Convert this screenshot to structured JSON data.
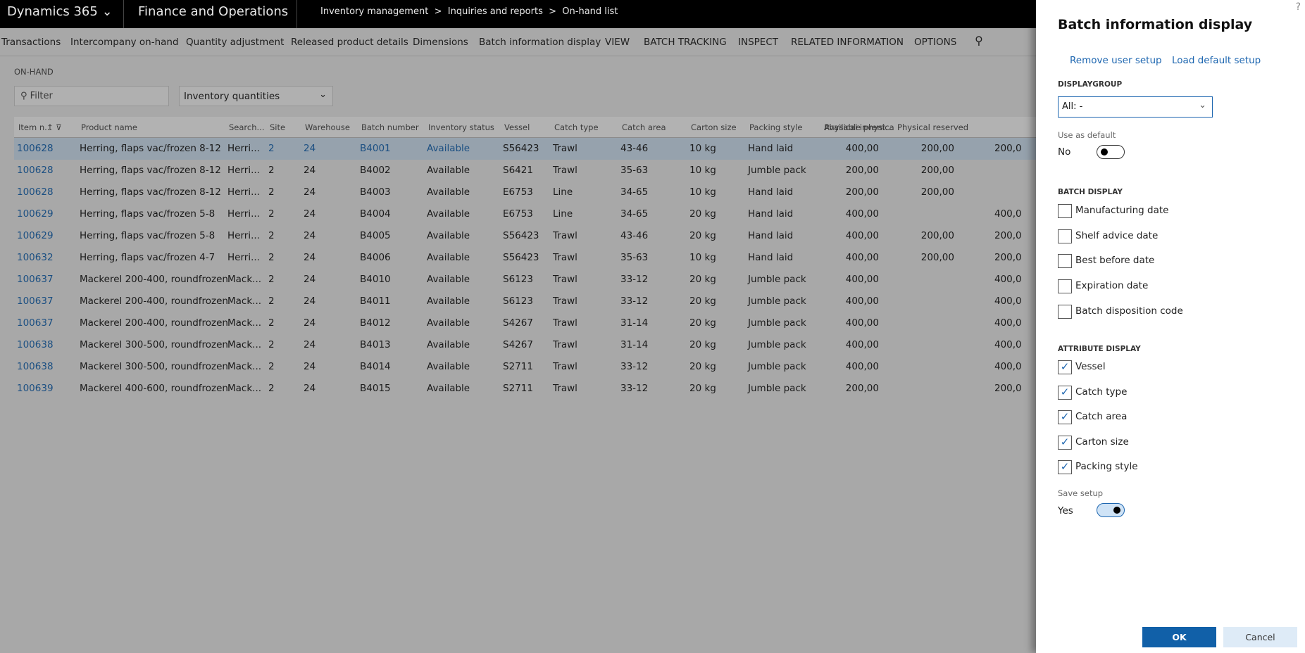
{
  "topbar": {
    "app": "Dynamics 365",
    "module": "Finance and Operations",
    "breadcrumb": [
      "Inventory management",
      "Inquiries and reports",
      "On-hand list"
    ]
  },
  "actions": [
    "Transactions",
    "Intercompany on-hand",
    "Quantity adjustment",
    "Released product details",
    "Dimensions",
    "Batch information display",
    "VIEW",
    "BATCH TRACKING",
    "INSPECT",
    "RELATED INFORMATION",
    "OPTIONS"
  ],
  "section": "ON-HAND",
  "filter": {
    "placeholder": "Filter"
  },
  "view_select": "Inventory quantities",
  "grid": {
    "columns": [
      "Item n...",
      "Product name",
      "Search...",
      "Site",
      "Warehouse",
      "Batch number",
      "Inventory status",
      "Vessel",
      "Catch type",
      "Catch area",
      "Carton size",
      "Packing style",
      "Physical invent...",
      "Physical reserved",
      "Available physica"
    ],
    "rows": [
      [
        "100628",
        "Herring, flaps vac/frozen 8-12",
        "Herri...",
        "2",
        "24",
        "B4001",
        "Available",
        "S56423",
        "Trawl",
        "43-46",
        "10 kg",
        "Hand laid",
        "400,00",
        "200,00",
        "200,0"
      ],
      [
        "100628",
        "Herring, flaps vac/frozen 8-12",
        "Herri...",
        "2",
        "24",
        "B4002",
        "Available",
        "S6421",
        "Trawl",
        "35-63",
        "10 kg",
        "Jumble pack",
        "200,00",
        "200,00",
        ""
      ],
      [
        "100628",
        "Herring, flaps vac/frozen 8-12",
        "Herri...",
        "2",
        "24",
        "B4003",
        "Available",
        "E6753",
        "Line",
        "34-65",
        "10 kg",
        "Hand laid",
        "200,00",
        "200,00",
        ""
      ],
      [
        "100629",
        "Herring, flaps vac/frozen 5-8",
        "Herri...",
        "2",
        "24",
        "B4004",
        "Available",
        "E6753",
        "Line",
        "34-65",
        "20 kg",
        "Hand laid",
        "400,00",
        "",
        "400,0"
      ],
      [
        "100629",
        "Herring, flaps vac/frozen 5-8",
        "Herri...",
        "2",
        "24",
        "B4005",
        "Available",
        "S56423",
        "Trawl",
        "43-46",
        "20 kg",
        "Hand laid",
        "400,00",
        "200,00",
        "200,0"
      ],
      [
        "100632",
        "Herring, flaps vac/frozen 4-7",
        "Herri...",
        "2",
        "24",
        "B4006",
        "Available",
        "S56423",
        "Trawl",
        "35-63",
        "10 kg",
        "Hand laid",
        "400,00",
        "200,00",
        "200,0"
      ],
      [
        "100637",
        "Mackerel 200-400, roundfrozen",
        "Mack...",
        "2",
        "24",
        "B4010",
        "Available",
        "S6123",
        "Trawl",
        "33-12",
        "20 kg",
        "Jumble pack",
        "400,00",
        "",
        "400,0"
      ],
      [
        "100637",
        "Mackerel 200-400, roundfrozen",
        "Mack...",
        "2",
        "24",
        "B4011",
        "Available",
        "S6123",
        "Trawl",
        "33-12",
        "20 kg",
        "Jumble pack",
        "400,00",
        "",
        "400,0"
      ],
      [
        "100637",
        "Mackerel 200-400, roundfrozen",
        "Mack...",
        "2",
        "24",
        "B4012",
        "Available",
        "S4267",
        "Trawl",
        "31-14",
        "20 kg",
        "Jumble pack",
        "400,00",
        "",
        "400,0"
      ],
      [
        "100638",
        "Mackerel 300-500, roundfrozen",
        "Mack...",
        "2",
        "24",
        "B4013",
        "Available",
        "S4267",
        "Trawl",
        "31-14",
        "20 kg",
        "Jumble pack",
        "400,00",
        "",
        "400,0"
      ],
      [
        "100638",
        "Mackerel 300-500, roundfrozen",
        "Mack...",
        "2",
        "24",
        "B4014",
        "Available",
        "S2711",
        "Trawl",
        "33-12",
        "20 kg",
        "Jumble pack",
        "400,00",
        "",
        "400,0"
      ],
      [
        "100639",
        "Mackerel 400-600, roundfrozen",
        "Mack...",
        "2",
        "24",
        "B4015",
        "Available",
        "S2711",
        "Trawl",
        "33-12",
        "20 kg",
        "Jumble pack",
        "200,00",
        "",
        "200,0"
      ]
    ]
  },
  "panel": {
    "help": "?",
    "title": "Batch information display",
    "remove_link": "Remove user setup",
    "load_link": "Load default setup",
    "displaygroup_label": "DISPLAYGROUP",
    "displaygroup_value": "All: -",
    "use_default_label": "Use as default",
    "use_default_value": "No",
    "batch_display_label": "BATCH DISPLAY",
    "batch_display": [
      {
        "label": "Manufacturing date",
        "checked": false
      },
      {
        "label": "Shelf advice date",
        "checked": false
      },
      {
        "label": "Best before date",
        "checked": false
      },
      {
        "label": "Expiration date",
        "checked": false
      },
      {
        "label": "Batch disposition code",
        "checked": false
      }
    ],
    "attribute_display_label": "ATTRIBUTE DISPLAY",
    "attribute_display": [
      {
        "label": "Vessel",
        "checked": true
      },
      {
        "label": "Catch type",
        "checked": true
      },
      {
        "label": "Catch area",
        "checked": true
      },
      {
        "label": "Carton size",
        "checked": true
      },
      {
        "label": "Packing style",
        "checked": true
      }
    ],
    "save_setup_label": "Save setup",
    "save_setup_value": "Yes",
    "ok": "OK",
    "cancel": "Cancel"
  },
  "colors": {
    "accent": "#1160a8",
    "link": "#1d66b0"
  }
}
